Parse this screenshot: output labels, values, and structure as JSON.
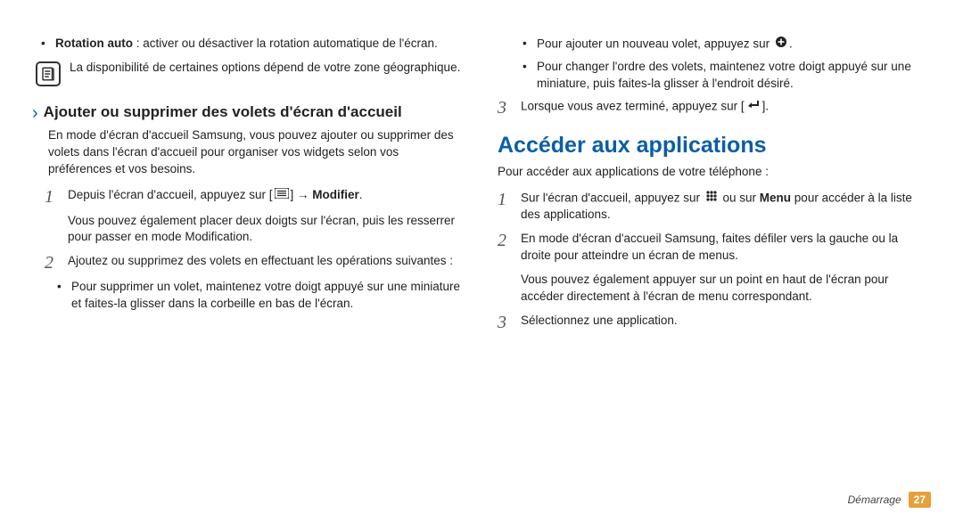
{
  "left": {
    "rotation_label": "Rotation auto",
    "rotation_text": " : activer ou désactiver la rotation automatique de l'écran.",
    "note": "La disponibilité de certaines options dépend de votre zone géographique.",
    "subheading": "Ajouter ou supprimer des volets d'écran d'accueil",
    "intro": "En mode d'écran d'accueil Samsung, vous pouvez ajouter ou supprimer des volets dans l'écran d'accueil pour organiser vos widgets selon vos préférences et vos besoins.",
    "step1_a": "Depuis l'écran d'accueil, appuyez sur [",
    "step1_b": "] → ",
    "step1_modifier": "Modifier",
    "step1_end": ".",
    "step1_cont": "Vous pouvez également placer deux doigts sur l'écran, puis les resserrer pour passer en mode Modification.",
    "step2": "Ajoutez ou supprimez des volets en effectuant les opérations suivantes :",
    "step2_b1": "Pour supprimer un volet, maintenez votre doigt appuyé sur une miniature et faites-la glisser dans la corbeille en bas de l'écran."
  },
  "right": {
    "b1_a": "Pour ajouter un nouveau volet, appuyez sur ",
    "b1_b": ".",
    "b2": "Pour changer l'ordre des volets, maintenez votre doigt appuyé sur une miniature, puis faites-la glisser à l'endroit désiré.",
    "step3_a": "Lorsque vous avez terminé, appuyez sur [",
    "step3_b": "].",
    "h2": "Accéder aux applications",
    "intro": "Pour accéder aux applications de votre téléphone :",
    "s1_a": "Sur l'écran d'accueil, appuyez sur ",
    "s1_b": " ou sur ",
    "s1_menu": "Menu",
    "s1_c": " pour accéder à la liste des applications.",
    "s2": "En mode d'écran d'accueil Samsung, faites défiler vers la gauche ou la droite pour atteindre un écran de menus.",
    "s2_cont": "Vous pouvez également appuyer sur un point en haut de l'écran pour accéder directement à l'écran de menu correspondant.",
    "s3": "Sélectionnez une application."
  },
  "footer": {
    "section": "Démarrage",
    "page": "27"
  }
}
